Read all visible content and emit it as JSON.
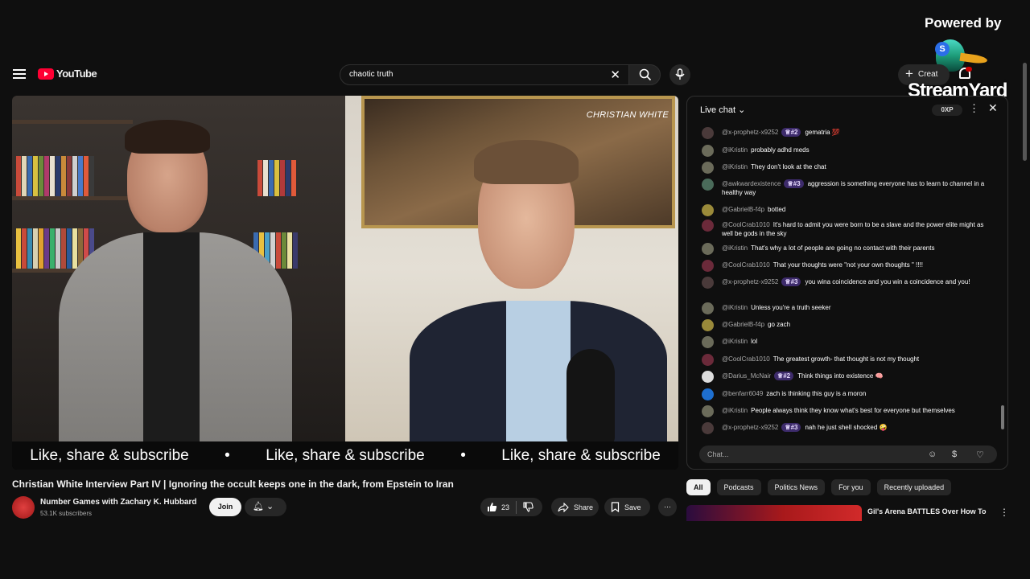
{
  "overlay": {
    "powered_by": "Powered by",
    "brand": "StreamYard"
  },
  "header": {
    "logo_text": "YouTube",
    "search_value": "chaotic truth",
    "create_label": "Creat"
  },
  "video": {
    "cam_label": "CHRISTIAN WHITE",
    "ticker": [
      "Like, share & subscribe",
      "•",
      "Like, share & subscribe",
      "•",
      "Like, share & subscribe"
    ],
    "title": "Christian White Interview Part IV | Ignoring the occult keeps one in the dark, from Epstein to Iran",
    "channel": "Number Games with Zachary K. Hubbard",
    "subscribers": "53.1K subscribers",
    "join_label": "Join",
    "like_count": "23",
    "share_label": "Share",
    "save_label": "Save"
  },
  "chat": {
    "title": "Live chat",
    "xp": "0XP",
    "input_placeholder": "Chat...",
    "messages": [
      {
        "author": "@x-prophetz-x9252",
        "badge": "♕#2",
        "text": "gematria 💯",
        "color": "#4a3a3a"
      },
      {
        "author": "@iKristin",
        "badge": "",
        "text": "probably adhd meds",
        "color": "#6b6b5a"
      },
      {
        "author": "@iKristin",
        "badge": "",
        "text": "They don't look at the chat",
        "color": "#6b6b5a"
      },
      {
        "author": "@awkwardexistence",
        "badge": "♕#3",
        "text": "aggression is something everyone has to learn to channel in a healthy way",
        "color": "#4a6b5a"
      },
      {
        "author": "@GabrielB-f4p",
        "badge": "",
        "text": "botted",
        "color": "#9a8a3a"
      },
      {
        "author": "@CoolCrab1010",
        "badge": "",
        "text": "It's hard to admit you were born to be a slave and the power elite might as well be gods in the sky",
        "color": "#6b2a3a"
      },
      {
        "author": "@iKristin",
        "badge": "",
        "text": "That's why a lot of people are going no contact with their parents",
        "color": "#6b6b5a"
      },
      {
        "author": "@CoolCrab1010",
        "badge": "",
        "text": "That your thoughts were \"not your own thoughts \" !!!!",
        "color": "#6b2a3a"
      },
      {
        "author": "@x-prophetz-x9252",
        "badge": "♕#3",
        "text": "you wina coincidence and you win a coincidence and you!",
        "color": "#4a3a3a"
      },
      {
        "author": "@iKristin",
        "badge": "",
        "text": "Unless you're a truth seeker",
        "color": "#6b6b5a"
      },
      {
        "author": "@GabrielB-f4p",
        "badge": "",
        "text": "go zach",
        "color": "#9a8a3a"
      },
      {
        "author": "@iKristin",
        "badge": "",
        "text": "lol",
        "color": "#6b6b5a"
      },
      {
        "author": "@CoolCrab1010",
        "badge": "",
        "text": "The greatest growth- that thought is not my thought",
        "color": "#6b2a3a"
      },
      {
        "author": "@Darius_McNair",
        "badge": "♕#2",
        "text": "Think things into existence 🧠",
        "color": "#dddddd"
      },
      {
        "author": "@benfarr6049",
        "badge": "",
        "text": "zach is thinking this guy is a moron",
        "color": "#1e6fcf"
      },
      {
        "author": "@iKristin",
        "badge": "",
        "text": "People always think they know what's best for everyone but themselves",
        "color": "#6b6b5a"
      },
      {
        "author": "@x-prophetz-x9252",
        "badge": "♕#3",
        "text": "nah he just shell shocked 🤪",
        "color": "#4a3a3a"
      }
    ]
  },
  "chips": [
    "All",
    "Podcasts",
    "Politics News",
    "For you",
    "Recently uploaded"
  ],
  "recommendation": {
    "title": "Gil's Arena BATTLES Over How To"
  }
}
